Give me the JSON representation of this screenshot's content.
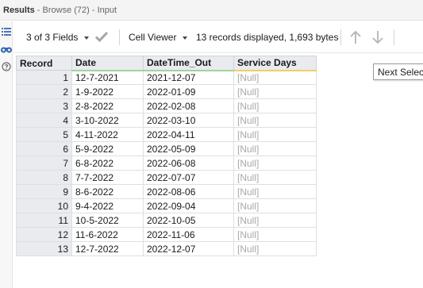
{
  "title": {
    "bold": "Results",
    "rest": " - Browse (72) - Input"
  },
  "toolbar": {
    "fields_label": "3 of 3 Fields",
    "viewer_label": "Cell Viewer",
    "summary": "13 records displayed, 1,693 bytes",
    "icons": [
      "checkmark-icon",
      "arrow-up-icon",
      "arrow-down-icon"
    ]
  },
  "left_rail": {
    "icons": [
      "list-icon",
      "binoculars-icon",
      "help-icon"
    ]
  },
  "tooltip": "Next Selected",
  "table": {
    "headers": [
      "Record",
      "Date",
      "DateTime_Out",
      "Service Days"
    ],
    "header_colors": {
      "date": "#9ed59b",
      "datetime_out": "#9ed59b",
      "service_days": "#f2cf63"
    },
    "rows": [
      {
        "record": "1",
        "date": "12-7-2021",
        "datetime_out": "2021-12-07",
        "service_days": "[Null]"
      },
      {
        "record": "2",
        "date": "1-9-2022",
        "datetime_out": "2022-01-09",
        "service_days": "[Null]"
      },
      {
        "record": "3",
        "date": "2-8-2022",
        "datetime_out": "2022-02-08",
        "service_days": "[Null]"
      },
      {
        "record": "4",
        "date": "3-10-2022",
        "datetime_out": "2022-03-10",
        "service_days": "[Null]"
      },
      {
        "record": "5",
        "date": "4-11-2022",
        "datetime_out": "2022-04-11",
        "service_days": "[Null]"
      },
      {
        "record": "6",
        "date": "5-9-2022",
        "datetime_out": "2022-05-09",
        "service_days": "[Null]"
      },
      {
        "record": "7",
        "date": "6-8-2022",
        "datetime_out": "2022-06-08",
        "service_days": "[Null]"
      },
      {
        "record": "8",
        "date": "7-7-2022",
        "datetime_out": "2022-07-07",
        "service_days": "[Null]"
      },
      {
        "record": "9",
        "date": "8-6-2022",
        "datetime_out": "2022-08-06",
        "service_days": "[Null]"
      },
      {
        "record": "10",
        "date": "9-4-2022",
        "datetime_out": "2022-09-04",
        "service_days": "[Null]"
      },
      {
        "record": "11",
        "date": "10-5-2022",
        "datetime_out": "2022-10-05",
        "service_days": "[Null]"
      },
      {
        "record": "12",
        "date": "11-6-2022",
        "datetime_out": "2022-11-06",
        "service_days": "[Null]"
      },
      {
        "record": "13",
        "date": "12-7-2022",
        "datetime_out": "2022-12-07",
        "service_days": "[Null]"
      }
    ]
  }
}
